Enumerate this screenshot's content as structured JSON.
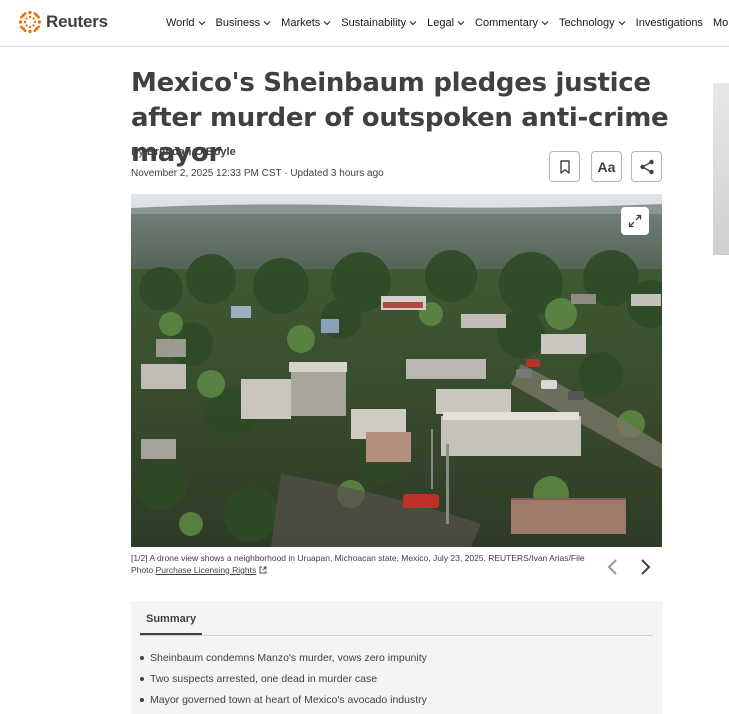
{
  "brand": {
    "name": "Reuters",
    "accent": "#fa6400"
  },
  "nav": [
    {
      "label": "World",
      "dropdown": true
    },
    {
      "label": "Business",
      "dropdown": true
    },
    {
      "label": "Markets",
      "dropdown": true
    },
    {
      "label": "Sustainability",
      "dropdown": true
    },
    {
      "label": "Legal",
      "dropdown": true
    },
    {
      "label": "Commentary",
      "dropdown": true
    },
    {
      "label": "Technology",
      "dropdown": true
    },
    {
      "label": "Investigations",
      "dropdown": false
    },
    {
      "label": "More",
      "dropdown": true
    }
  ],
  "article": {
    "headline": "Mexico's Sheinbaum pledges justice after murder of outspoken anti-crime mayor",
    "by_prefix": "By",
    "author": "Brendan O'Boyle",
    "dateline": "November 2, 2025 12:33 PM CST · Updated 3 hours ago",
    "tools": {
      "bookmark_icon": "bookmark-icon",
      "text_size_label": "Aa",
      "share_icon": "share-icon"
    }
  },
  "gallery": {
    "counter": "[1/2]",
    "caption": "A drone view shows a neighborhood in Uruapan, Michoacan state, Mexico, July 23, 2025. REUTERS/Ivan Arias/File Photo",
    "licensing_link": "Purchase Licensing Rights"
  },
  "summary": {
    "tab_label": "Summary",
    "points": [
      "Sheinbaum condemns Manzo's murder, vows zero impunity",
      "Two suspects arrested, one dead in murder case",
      "Mayor governed town at heart of Mexico's avocado industry"
    ]
  }
}
